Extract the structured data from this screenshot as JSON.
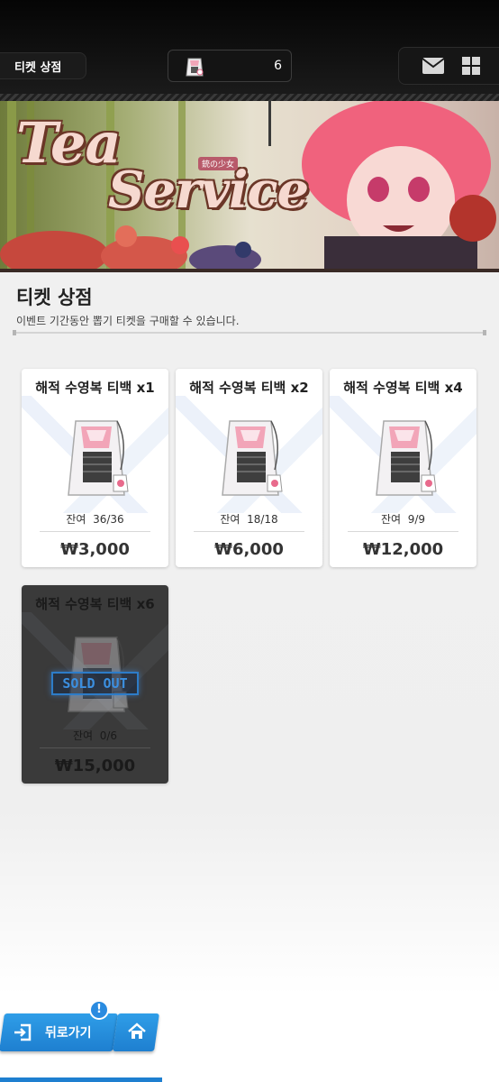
{
  "header": {
    "shop_tab_label": "티켓 상점",
    "ticket_count": "6",
    "icons": [
      "ticket-bag-icon",
      "mail-icon",
      "grid-menu-icon"
    ]
  },
  "banner": {
    "title_line1": "Tea",
    "title_line2": "Service",
    "subtitle": "銃の少女"
  },
  "section": {
    "title": "티켓 상점",
    "description": "이벤트 기간동안 뽑기 티켓을 구매할 수 있습니다."
  },
  "products": [
    {
      "title": "해적 수영복 티백 x1",
      "stock_label": "잔여",
      "stock": "36/36",
      "price": "₩3,000",
      "sold_out": false
    },
    {
      "title": "해적 수영복 티백 x2",
      "stock_label": "잔여",
      "stock": "18/18",
      "price": "₩6,000",
      "sold_out": false
    },
    {
      "title": "해적 수영복 티백 x4",
      "stock_label": "잔여",
      "stock": "9/9",
      "price": "₩12,000",
      "sold_out": false
    },
    {
      "title": "해적 수영복 티백 x6",
      "stock_label": "잔여",
      "stock": "0/6",
      "price": "₩15,000",
      "sold_out": true,
      "overlay": "SOLD OUT"
    }
  ],
  "bottom_nav": {
    "back_label": "뒤로가기",
    "alert_badge": "!",
    "icons": [
      "exit-icon",
      "home-icon"
    ]
  },
  "colors": {
    "accent_blue": "#1e7fd0",
    "sold_out_blue": "#3b8fe0",
    "tea_pink": "#f2a5b8"
  }
}
